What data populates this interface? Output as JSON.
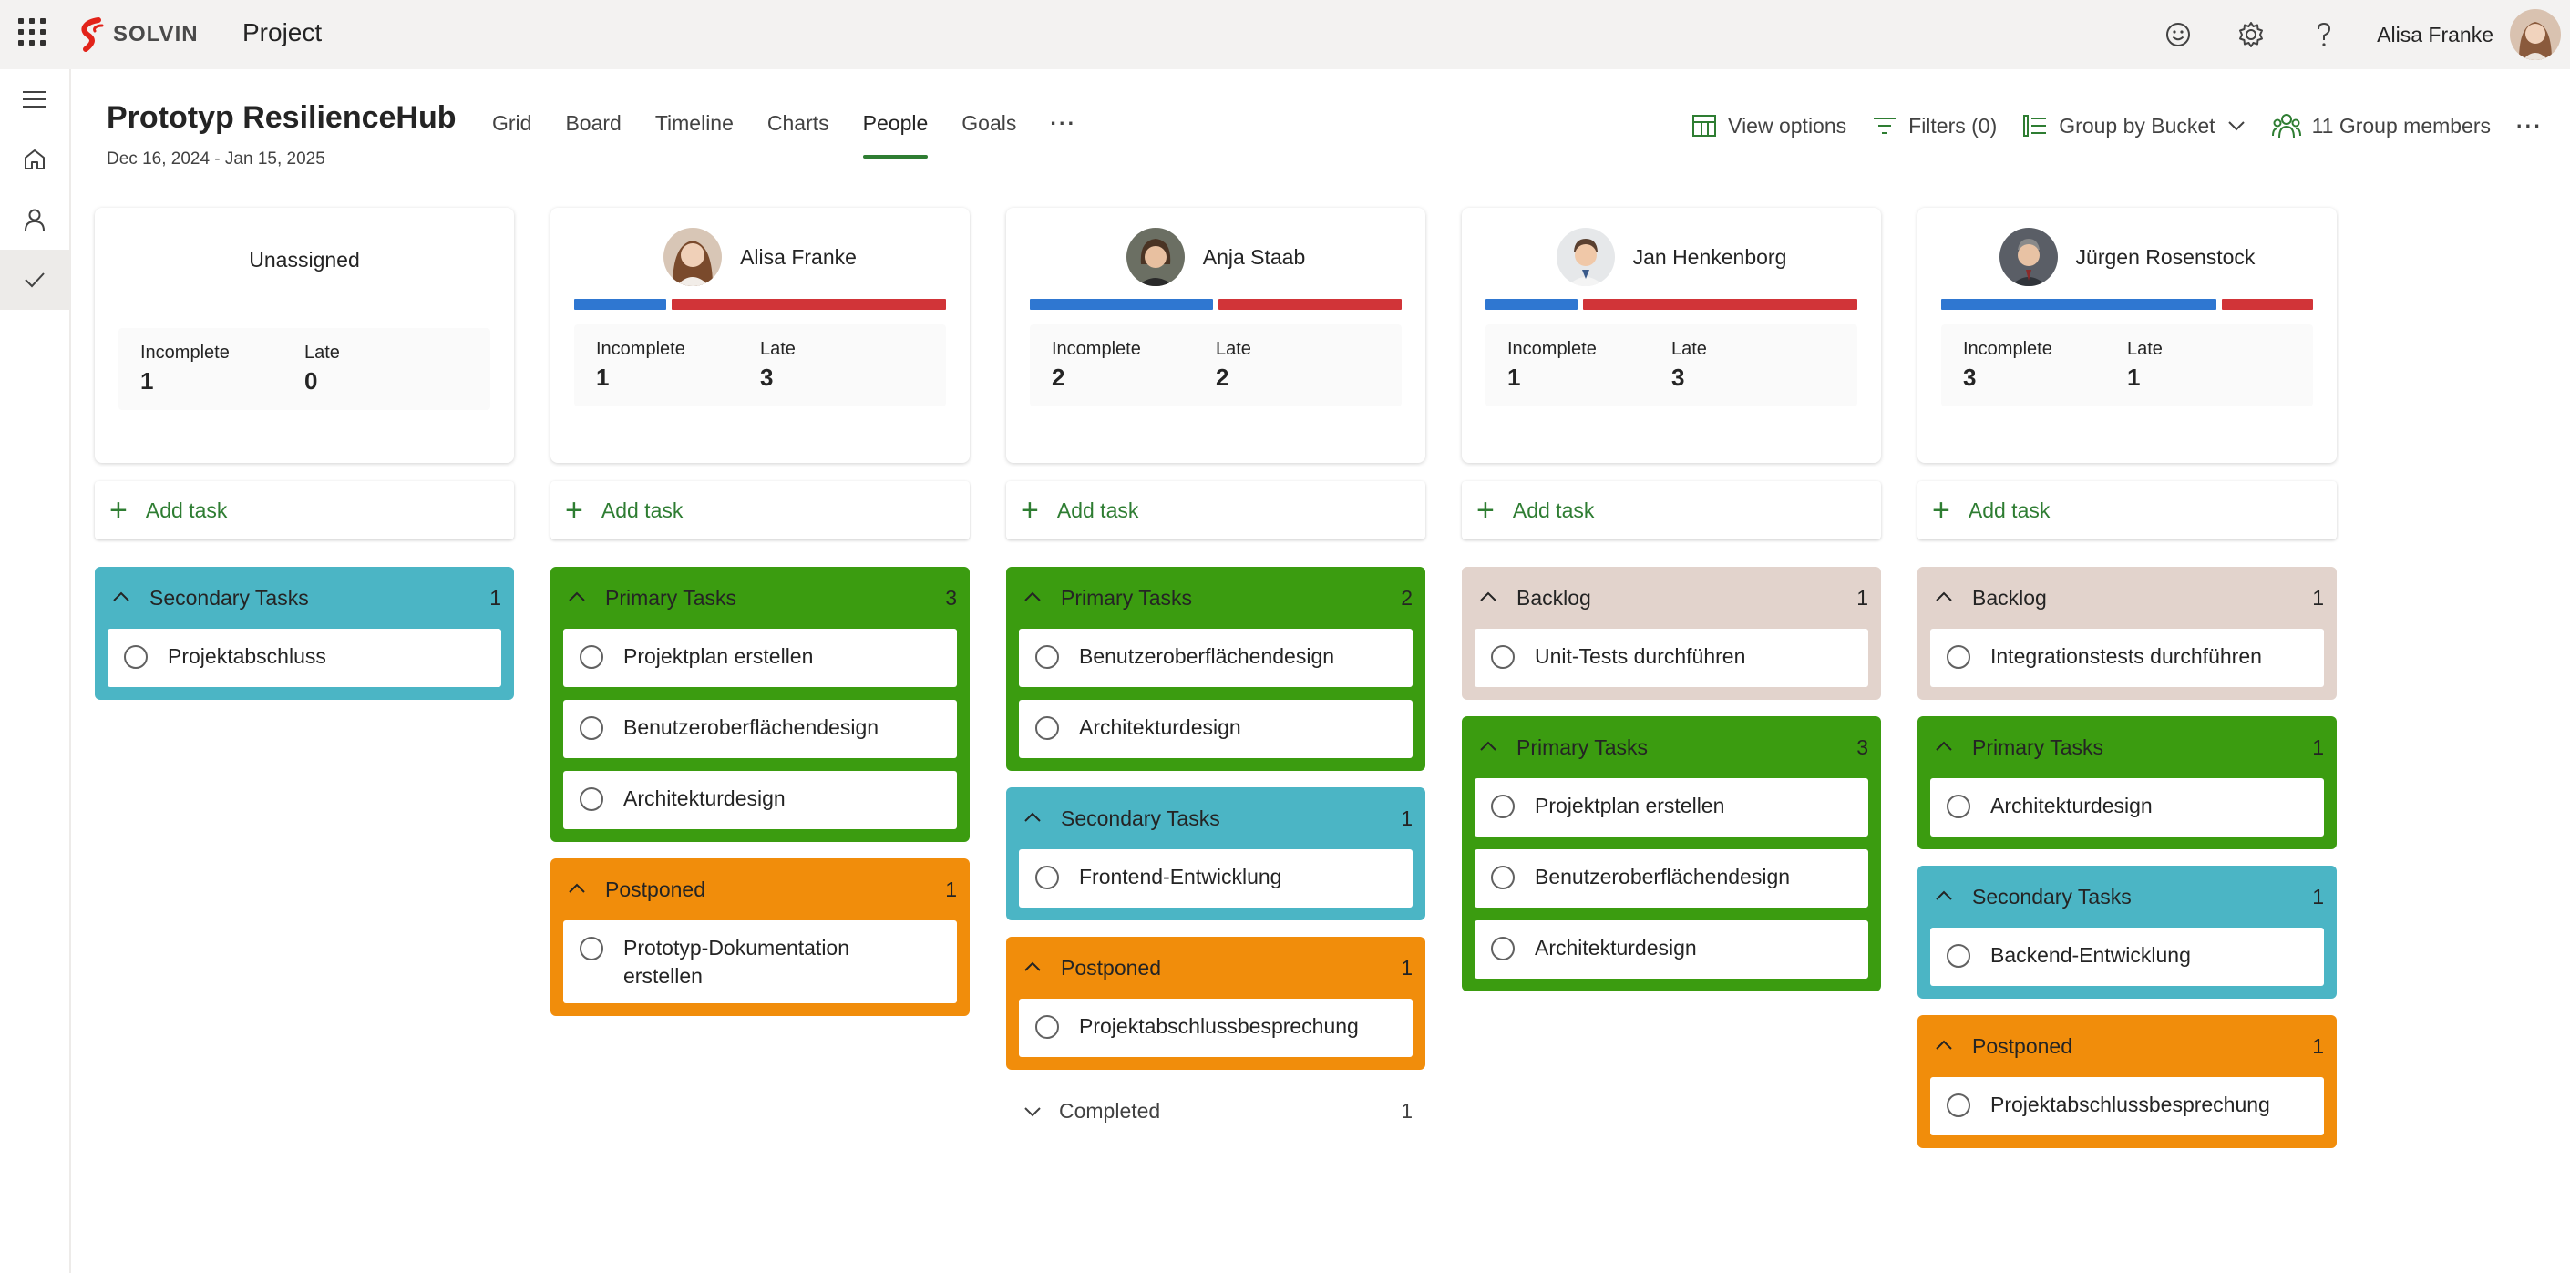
{
  "app": {
    "brand": "SOLVIN",
    "title": "Project",
    "user_name": "Alisa Franke",
    "icons": [
      "waffle-icon",
      "smiley-icon",
      "gear-icon",
      "help-icon"
    ]
  },
  "rail": {
    "items": [
      "menu-icon",
      "home-icon",
      "person-icon",
      "checkmark-icon"
    ]
  },
  "plan": {
    "title": "Prototyp ResilienceHub",
    "dates": "Dec 16, 2024 - Jan 15, 2025"
  },
  "tabs": [
    "Grid",
    "Board",
    "Timeline",
    "Charts",
    "People",
    "Goals",
    "···"
  ],
  "active_tab": "People",
  "toolbar": {
    "view_options": "View options",
    "filters": "Filters (0)",
    "group_by": "Group by Bucket",
    "members": "11 Group members",
    "more": "···"
  },
  "colors": {
    "accent": "#2e7d32",
    "bar_incomplete": "#2f77d1",
    "bar_late": "#d13438",
    "primary": "#3b9c10",
    "secondary": "#4bb5c5",
    "postponed": "#f18d0b",
    "backlog": "#e2d3cc"
  },
  "labels": {
    "incomplete": "Incomplete",
    "late": "Late",
    "add_task": "Add task"
  },
  "columns": [
    {
      "name": "Unassigned",
      "incomplete": "1",
      "late": "0",
      "buckets": [
        {
          "name": "Secondary Tasks",
          "count": "1",
          "tasks": [
            "Projektabschluss"
          ]
        }
      ]
    },
    {
      "name": "Alisa Franke",
      "incomplete": "1",
      "late": "3",
      "buckets": [
        {
          "name": "Primary Tasks",
          "count": "3",
          "tasks": [
            "Projektplan erstellen",
            "Benutzeroberflächendesign",
            "Architekturdesign"
          ]
        },
        {
          "name": "Postponed",
          "count": "1",
          "tasks": [
            "Prototyp-Dokumentation erstellen"
          ]
        }
      ]
    },
    {
      "name": "Anja Staab",
      "incomplete": "2",
      "late": "2",
      "buckets": [
        {
          "name": "Primary Tasks",
          "count": "2",
          "tasks": [
            "Benutzeroberflächendesign",
            "Architekturdesign"
          ]
        },
        {
          "name": "Secondary Tasks",
          "count": "1",
          "tasks": [
            "Frontend-Entwicklung"
          ]
        },
        {
          "name": "Postponed",
          "count": "1",
          "tasks": [
            "Projektabschlussbesprechung"
          ]
        }
      ],
      "completed": {
        "label": "Completed",
        "count": "1"
      }
    },
    {
      "name": "Jan Henkenborg",
      "incomplete": "1",
      "late": "3",
      "buckets": [
        {
          "name": "Backlog",
          "count": "1",
          "tasks": [
            "Unit-Tests durchführen"
          ]
        },
        {
          "name": "Primary Tasks",
          "count": "3",
          "tasks": [
            "Projektplan erstellen",
            "Benutzeroberflächendesign",
            "Architekturdesign"
          ]
        }
      ]
    },
    {
      "name": "Jürgen Rosenstock",
      "incomplete": "3",
      "late": "1",
      "buckets": [
        {
          "name": "Backlog",
          "count": "1",
          "tasks": [
            "Integrationstests durchführen"
          ]
        },
        {
          "name": "Primary Tasks",
          "count": "1",
          "tasks": [
            "Architekturdesign"
          ]
        },
        {
          "name": "Secondary Tasks",
          "count": "1",
          "tasks": [
            "Backend-Entwicklung"
          ]
        },
        {
          "name": "Postponed",
          "count": "1",
          "tasks": [
            "Projektabschlussbesprechung"
          ]
        }
      ]
    }
  ]
}
